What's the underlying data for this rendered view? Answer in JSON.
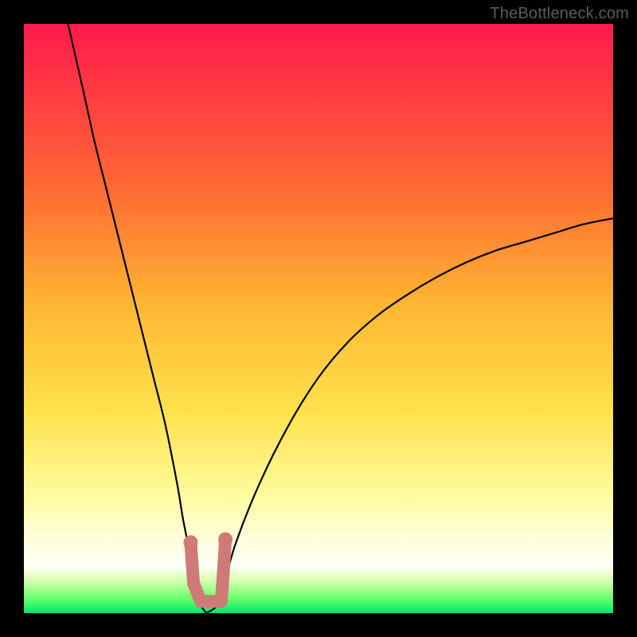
{
  "watermark": "TheBottleneck.com",
  "colors": {
    "bg_top": "#ff1a4d",
    "bg_upper_mid": "#ff6a33",
    "bg_mid": "#ffb733",
    "bg_lower_mid": "#ffe24d",
    "bg_pale_yellow": "#fffb9e",
    "bg_cream": "#ffffe0",
    "bg_white": "#ffffff",
    "green_top": "#d9ffb3",
    "green_mid": "#66ff66",
    "green_bottom": "#00e673",
    "curve": "#000000",
    "marker_fill": "#d07a78",
    "marker_stroke": "#b85a58"
  },
  "chart_data": {
    "type": "line",
    "title": "",
    "xlabel": "",
    "ylabel": "",
    "xlim": [
      0,
      100
    ],
    "ylim": [
      0,
      100
    ],
    "grid": false,
    "legend": null,
    "note": "Bottleneck-style curve chart. Two black curves meet near x≈31 where y≈0 (optimal). Left curve rises to y≈100 at x=0; right curve rises to y≈67 at x=100. Coral marker segments highlight the region around the minimum.",
    "series": [
      {
        "name": "left_branch",
        "x": [
          7.5,
          10,
          12,
          14,
          16,
          18,
          20,
          22,
          24,
          26,
          27,
          28,
          29,
          30,
          31
        ],
        "y": [
          100,
          89,
          80,
          72,
          64,
          56,
          48,
          40,
          32,
          22,
          16,
          11,
          6,
          1.5,
          0
        ]
      },
      {
        "name": "right_branch",
        "x": [
          31,
          33,
          34,
          36,
          40,
          45,
          50,
          55,
          60,
          65,
          70,
          75,
          80,
          85,
          90,
          95,
          100
        ],
        "y": [
          0,
          1.5,
          5,
          12,
          22,
          32,
          40,
          46,
          50.5,
          54,
          57,
          59.5,
          61.5,
          63,
          64.5,
          66,
          67
        ]
      }
    ],
    "markers": {
      "description": "Coral thick segments approximating a small 'u' shape at the curve minimum",
      "points": [
        {
          "x": 28.3,
          "y": 12.0
        },
        {
          "x": 28.8,
          "y": 5.0
        },
        {
          "x": 30.0,
          "y": 2.0
        },
        {
          "x": 32.0,
          "y": 2.0
        },
        {
          "x": 33.5,
          "y": 2.0
        },
        {
          "x": 34.0,
          "y": 9.0
        },
        {
          "x": 34.2,
          "y": 12.5
        }
      ]
    },
    "green_band": {
      "y_top": 8,
      "y_bottom": 0
    }
  }
}
